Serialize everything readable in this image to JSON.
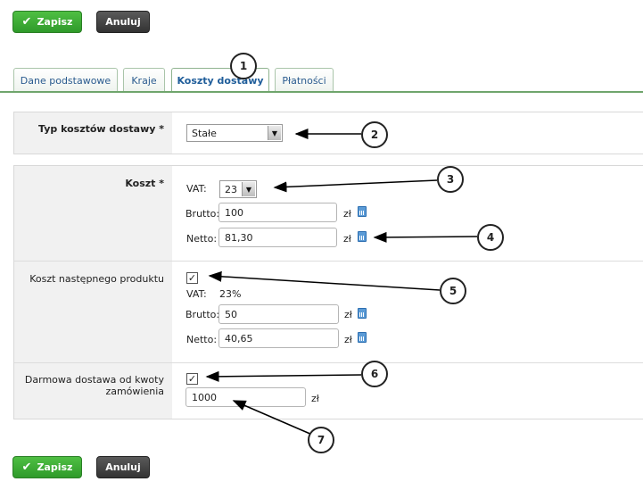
{
  "toolbar": {
    "save_label": "Zapisz",
    "cancel_label": "Anuluj"
  },
  "tabs": [
    {
      "label": "Dane podstawowe"
    },
    {
      "label": "Kraje"
    },
    {
      "label": "Koszty dostawy",
      "active": true
    },
    {
      "label": "Płatności"
    }
  ],
  "shipping_type": {
    "label": "Typ kosztów dostawy *",
    "selected": "Stałe"
  },
  "cost": {
    "label": "Koszt *",
    "vat_label": "VAT:",
    "vat_selected": "23",
    "gross_label": "Brutto:",
    "gross_value": "100",
    "net_label": "Netto:",
    "net_value": "81,30",
    "currency": "zł"
  },
  "next_product": {
    "label": "Koszt następnego produktu",
    "checked": true,
    "vat_label": "VAT:",
    "vat_value": "23%",
    "gross_label": "Brutto:",
    "gross_value": "50",
    "net_label": "Netto:",
    "net_value": "40,65",
    "currency": "zł"
  },
  "free_shipping": {
    "label_line1": "Darmowa dostawa od kwoty",
    "label_line2": "zamówienia",
    "checked": true,
    "value": "1000",
    "currency": "zł"
  },
  "callouts": [
    "1",
    "2",
    "3",
    "4",
    "5",
    "6",
    "7"
  ],
  "icons": {
    "save": "check-icon",
    "calculator": "calculator-icon",
    "dropdown": "chevron-down-icon"
  },
  "colors": {
    "save_green": "#3aa834",
    "cancel_dark": "#3e3e3e",
    "tab_line": "#6fa56c",
    "label_bg": "#f1f1f1"
  }
}
